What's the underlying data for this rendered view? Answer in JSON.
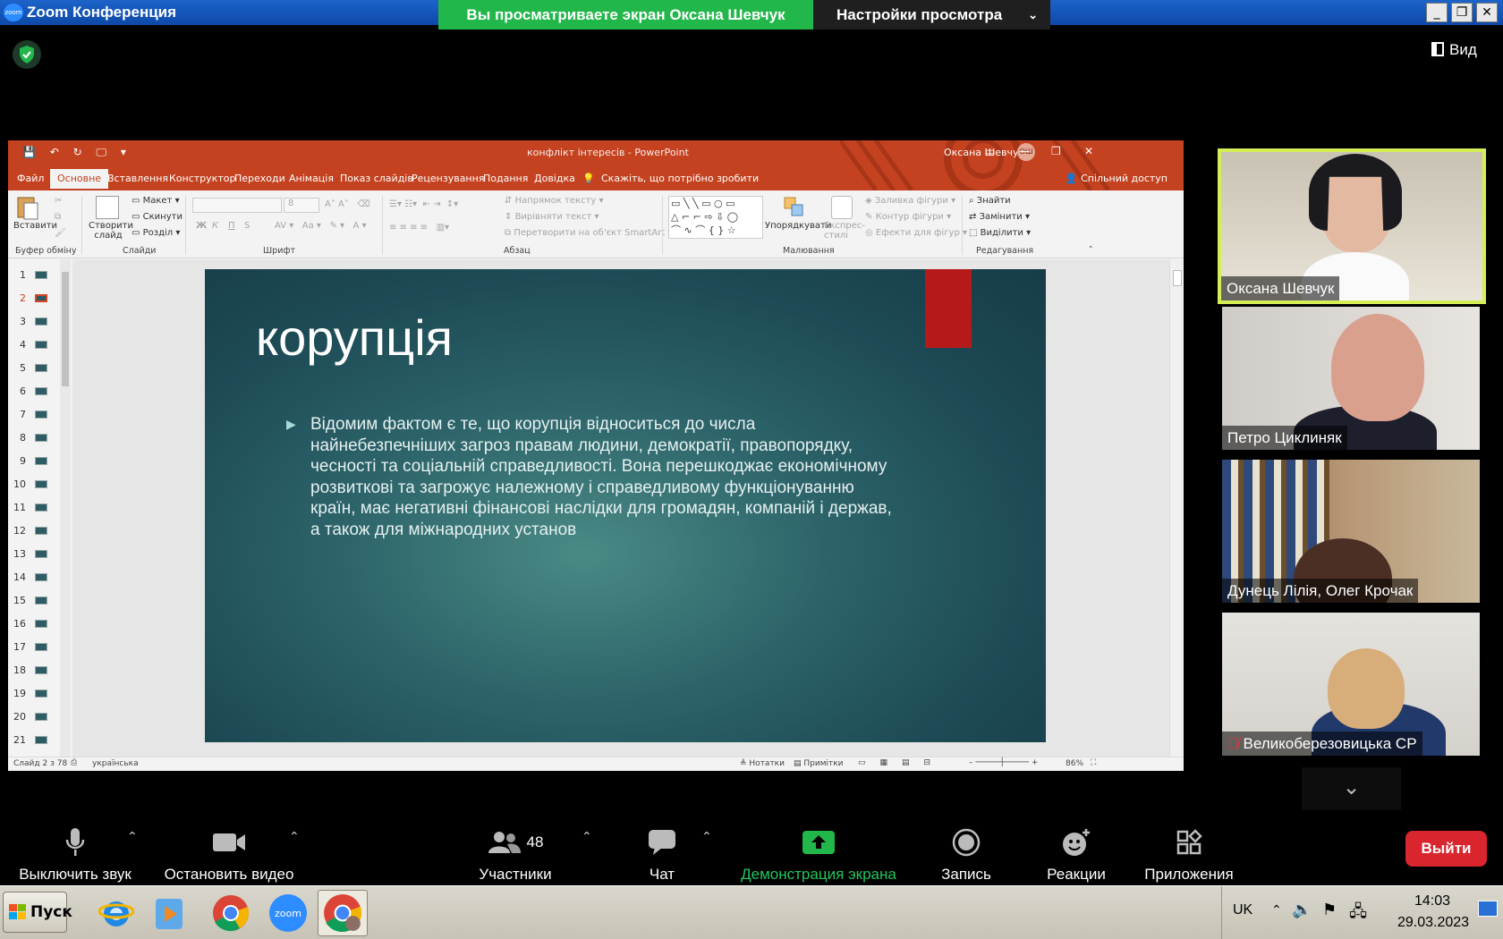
{
  "window": {
    "title": "Zoom Конференция",
    "buttons": [
      "_",
      "❐",
      "✕"
    ]
  },
  "share_banner": {
    "text": "Вы просматриваете экран Оксана Шевчук",
    "view_options": "Настройки просмотра"
  },
  "view_button": "Вид",
  "ppt": {
    "doc_title": "конфлікт інтересів  -  PowerPoint",
    "user": "Оксана Шевчук",
    "user_initials": "ОШ",
    "tabs": [
      "Файл",
      "Основне",
      "Вставлення",
      "Конструктор",
      "Переходи",
      "Анімація",
      "Показ слайдів",
      "Рецензування",
      "Подання",
      "Довідка"
    ],
    "active_tab": "Основне",
    "tell_me": "Скажіть, що потрібно зробити",
    "share": "Спільний доступ",
    "ribbon": {
      "paste": "Вставити",
      "new_slide": "Створити слайд",
      "layout": "Макет",
      "reset": "Скинути",
      "section": "Розділ",
      "text_direction": "Напрямок тексту",
      "align_text": "Вирівняти текст",
      "smartart": "Перетворити на об'єкт SmartArt",
      "arrange": "Упорядкувати",
      "quick_styles": "Експрес-стилі",
      "shape_fill": "Заливка фігури",
      "shape_outline": "Контур фігури",
      "shape_effects": "Ефекти для фігур",
      "find": "Знайти",
      "replace": "Замінити",
      "select": "Виділити",
      "font_size": "8",
      "bold": "Ж",
      "italic": "К",
      "underline": "П",
      "shadow": "S",
      "groups": [
        "Буфер обміну",
        "Слайди",
        "Шрифт",
        "Абзац",
        "Малювання",
        "Редагування"
      ]
    },
    "thumbnails": [
      "1",
      "2",
      "3",
      "4",
      "5",
      "6",
      "7",
      "8",
      "9",
      "10",
      "11",
      "12",
      "13",
      "14",
      "15",
      "16",
      "17",
      "18",
      "19",
      "20",
      "21"
    ],
    "selected_slide": "2",
    "slide": {
      "title": "корупція",
      "body": "Відомим фактом є те, що корупція відноситься до числа найнебезпечніших загроз правам людини, демократії, правопорядку, чесності та соціальній справедливості. Вона перешкоджає економічному розвиткові та загрожує належному і справедливому функціонуванню країн, має негативні фінансові наслідки для громадян, компаній і держав, а також для міжнародних установ"
    },
    "status": {
      "slide_info": "Слайд 2 з 78",
      "language": "українська",
      "notes": "Нотатки",
      "comments": "Примітки",
      "zoom": "86%"
    }
  },
  "participants": [
    {
      "name": "Оксана Шевчук",
      "active": true
    },
    {
      "name": "Петро Циклиняк",
      "active": false
    },
    {
      "name": "Дунець Лілія, Олег Крочак",
      "active": false
    },
    {
      "name": "Великоберезовицька СР",
      "active": false,
      "muted": true
    }
  ],
  "toolbar": {
    "mute": "Выключить звук",
    "video": "Остановить видео",
    "participants": "Участники",
    "participants_count": "48",
    "chat": "Чат",
    "share": "Демонстрация экрана",
    "record": "Запись",
    "reactions": "Реакции",
    "apps": "Приложения",
    "leave": "Выйти"
  },
  "taskbar": {
    "start": "Пуск",
    "lang": "UK",
    "time": "14:03",
    "date": "29.03.2023"
  },
  "colors": {
    "ppt_accent": "#c4421f",
    "share_green": "#22b74a",
    "leave_red": "#d8252e",
    "active_speaker": "#d6ee56"
  }
}
